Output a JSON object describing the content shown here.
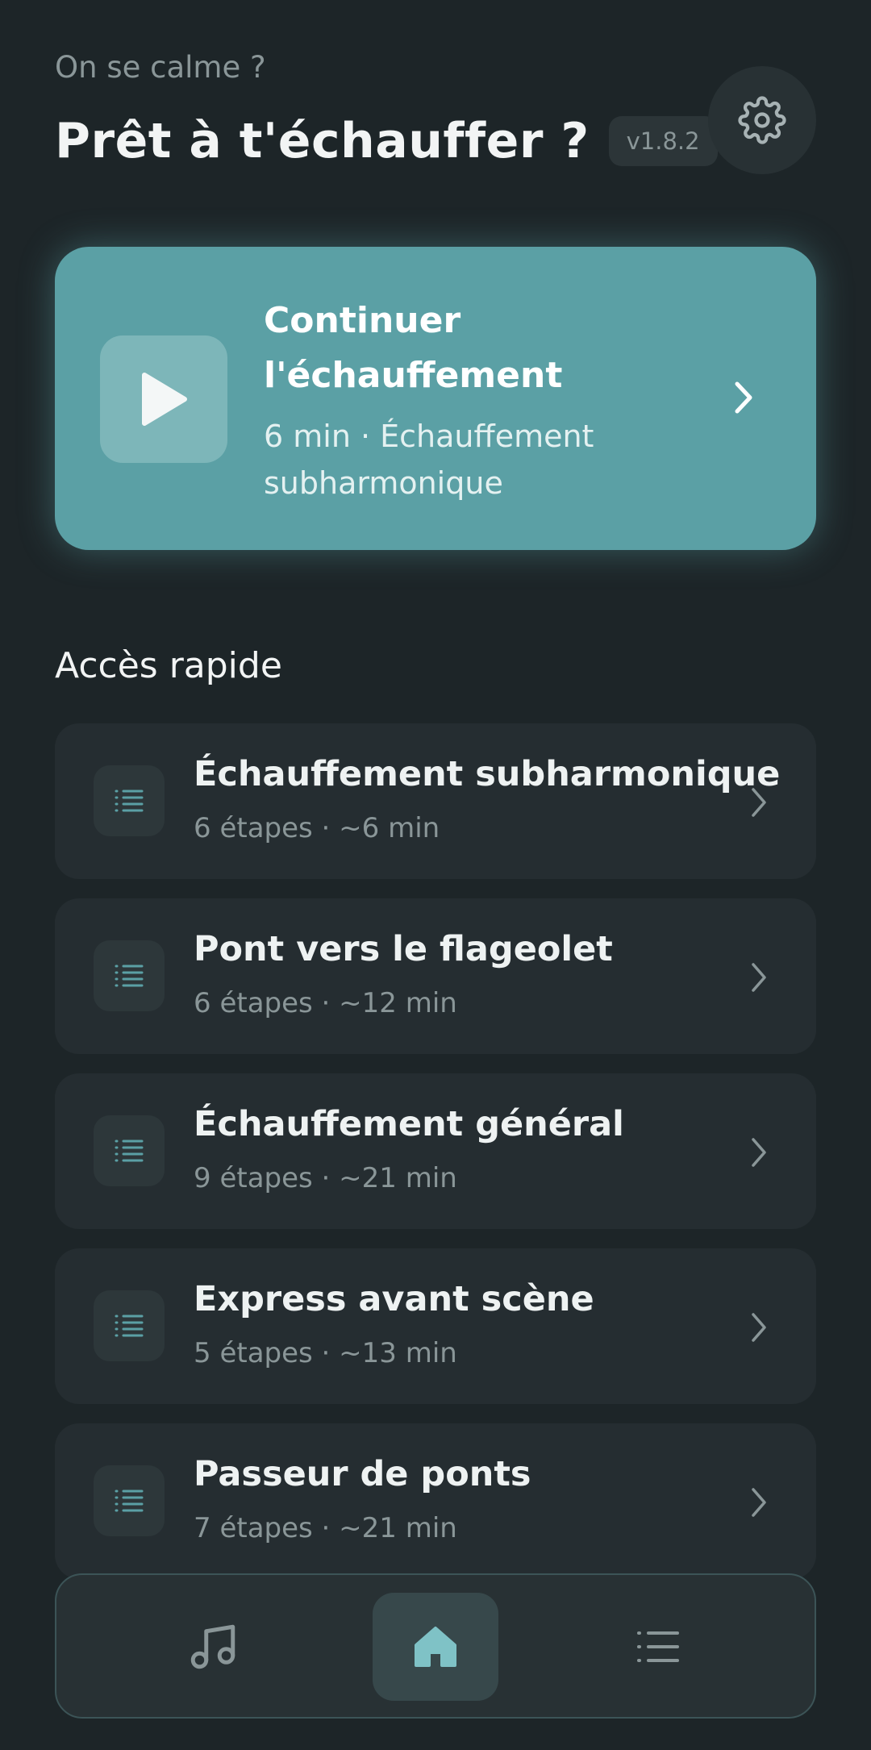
{
  "header": {
    "subtitle": "On se calme ?",
    "title": "Prêt à t'échauffer ?",
    "version": "v1.8.2",
    "settings_icon": "gear-icon"
  },
  "hero": {
    "title": "Continuer l'échauffement",
    "subtitle": "6 min · Échauffement subharmonique",
    "icon": "play-icon",
    "color": "#5ba0a5"
  },
  "quick_access": {
    "title": "Accès rapide",
    "items": [
      {
        "title": "Échauffement subharmonique",
        "meta": "6 étapes · ~6 min"
      },
      {
        "title": "Pont vers le flageolet",
        "meta": "6 étapes · ~12 min"
      },
      {
        "title": "Échauffement général",
        "meta": "9 étapes · ~21 min"
      },
      {
        "title": "Express avant scène",
        "meta": "5 étapes · ~13 min"
      },
      {
        "title": "Passeur de ponts",
        "meta": "7 étapes · ~21 min"
      }
    ]
  },
  "bottom_nav": {
    "items": [
      {
        "icon": "music-note-icon",
        "active": false
      },
      {
        "icon": "home-icon",
        "active": true
      },
      {
        "icon": "list-icon",
        "active": false
      }
    ]
  },
  "colors": {
    "background": "#1d2528",
    "card": "#252d31",
    "accent": "#5ba0a5",
    "muted_text": "#8a9698"
  }
}
